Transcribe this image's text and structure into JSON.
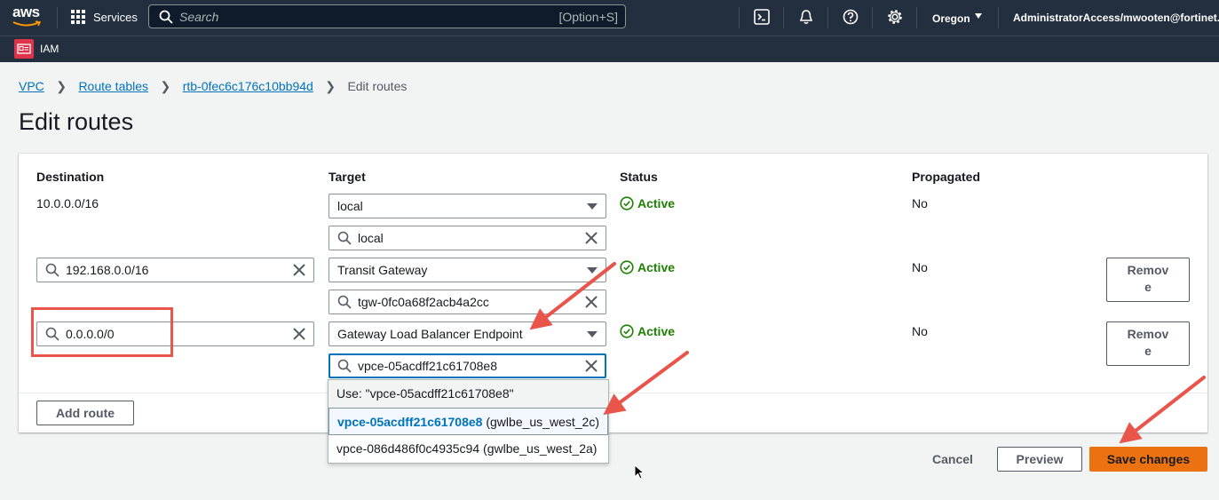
{
  "nav": {
    "logo": "aws",
    "services": "Services",
    "search_placeholder": "Search",
    "search_shortcut": "[Option+S]",
    "region": "Oregon",
    "account": "AdministratorAccess/mwooten@fortinet.c",
    "sub_item": "IAM"
  },
  "breadcrumb": {
    "vpc": "VPC",
    "route_tables": "Route tables",
    "rtb": "rtb-0fec6c176c10bb94d",
    "current": "Edit routes",
    "sep": ">"
  },
  "page_title": "Edit routes",
  "columns": {
    "destination": "Destination",
    "target": "Target",
    "status": "Status",
    "propagated": "Propagated"
  },
  "routes": [
    {
      "destination": "10.0.0.0/16",
      "target_type": "local",
      "target_value": "local",
      "status": "Active",
      "propagated": "No"
    },
    {
      "destination": "192.168.0.0/16",
      "target_type": "Transit Gateway",
      "target_value": "tgw-0fc0a68f2acb4a2cc",
      "status": "Active",
      "propagated": "No",
      "remove": "Remov e"
    },
    {
      "destination": "0.0.0.0/0",
      "target_type": "Gateway Load Balancer Endpoint",
      "target_value": "vpce-05acdff21c61708e8",
      "status": "Active",
      "propagated": "No",
      "remove": "Remov e"
    }
  ],
  "remove_label_line1": "Remov",
  "remove_label_line2": "e",
  "dropdown": {
    "use_option": "Use: \"vpce-05acdff21c61708e8\"",
    "option1_id": "vpce-05acdff21c61708e8",
    "option1_name": "(gwlbe_us_west_2c)",
    "option2_id": "vpce-086d486f0c4935c94",
    "option2_name": "(gwlbe_us_west_2a)"
  },
  "buttons": {
    "add_route": "Add route",
    "cancel": "Cancel",
    "preview": "Preview",
    "save": "Save changes"
  },
  "colors": {
    "nav_bg": "#232f3e",
    "link": "#0073bb",
    "success": "#1d8102",
    "primary": "#ec7211",
    "annotation": "#e9544b"
  }
}
